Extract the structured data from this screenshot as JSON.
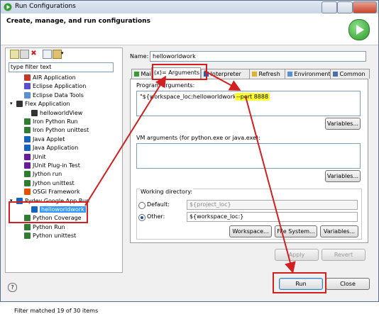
{
  "window": {
    "title": "Run Configurations"
  },
  "header": {
    "title": "Create, manage, and run configurations"
  },
  "left": {
    "filter_placeholder": "type filter text",
    "tree": [
      {
        "label": "AIR Application",
        "color": "#c0392b"
      },
      {
        "label": "Eclipse Application",
        "color": "#5a4fcf"
      },
      {
        "label": "Eclipse Data Tools",
        "color": "#5a8fd0"
      },
      {
        "label": "Flex Application",
        "color": "#333333"
      },
      {
        "label": "helloworldView",
        "color": "#333333"
      },
      {
        "label": "Iron Python Run",
        "color": "#2e7d32"
      },
      {
        "label": "Iron Python unittest",
        "color": "#2e7d32"
      },
      {
        "label": "Java Applet",
        "color": "#1565c0"
      },
      {
        "label": "Java Application",
        "color": "#1565c0"
      },
      {
        "label": "JUnit",
        "color": "#6a1b9a"
      },
      {
        "label": "JUnit Plug-in Test",
        "color": "#6a1b9a"
      },
      {
        "label": "Jython run",
        "color": "#2e7d32"
      },
      {
        "label": "Jython unittest",
        "color": "#2e7d32"
      },
      {
        "label": "OSGi Framework",
        "color": "#e65100"
      },
      {
        "label": "Pydev Google App Run",
        "color": "#1565c0"
      },
      {
        "label": "helloworldwork",
        "color": "#1565c0"
      },
      {
        "label": "Python Coverage",
        "color": "#2e7d32"
      },
      {
        "label": "Python Run",
        "color": "#2e7d32"
      },
      {
        "label": "Python unittest",
        "color": "#2e7d32"
      }
    ],
    "status": "Filter matched 19 of 30 items"
  },
  "right": {
    "name_label": "Name:",
    "name_value": "helloworldwork",
    "tabs": [
      "Main",
      "Arguments",
      "Interpreter",
      "Refresh",
      "Environment",
      "Common"
    ],
    "program_args_label": "Program arguments:",
    "program_args_value": "\"${workspace_loc:helloworldwork}\"",
    "program_args_added": "--port 8888",
    "variables_label": "Variables...",
    "vm_args_label": "VM arguments (for python.exe or java.exe):",
    "working_dir_label": "Working directory:",
    "default_label": "Default:",
    "default_value": "${project_loc}",
    "other_label": "Other:",
    "other_value": "${workspace_loc:}",
    "workspace_btn": "Workspace...",
    "filesystem_btn": "File System...",
    "variables_btn2": "Variables...",
    "apply_btn": "Apply",
    "revert_btn": "Revert"
  },
  "bottom": {
    "run_btn": "Run",
    "close_btn": "Close",
    "help": "?"
  },
  "colors": {
    "annotation": "#d21f1f",
    "highlight": "#ffff33"
  }
}
